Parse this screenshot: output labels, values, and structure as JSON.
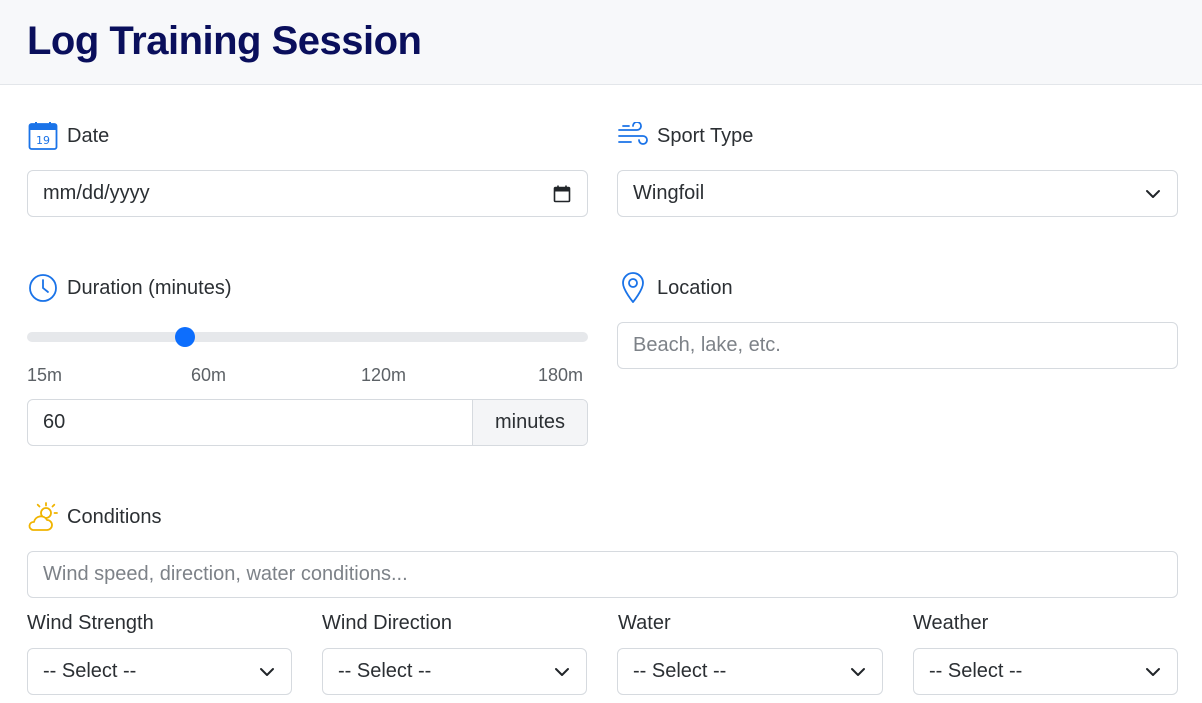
{
  "header": {
    "title": "Log Training Session"
  },
  "date": {
    "label": "Date",
    "placeholder": "mm/dd/yyyy",
    "icon": "calendar-icon",
    "icon_day": "19"
  },
  "sport": {
    "label": "Sport Type",
    "value": "Wingfoil",
    "icon": "wind-icon"
  },
  "duration": {
    "label": "Duration (minutes)",
    "icon": "clock-icon",
    "slider_value": 60,
    "slider_min": 15,
    "slider_max": 180,
    "ticks": [
      "15m",
      "60m",
      "120m",
      "180m"
    ],
    "value": "60",
    "unit": "minutes"
  },
  "location": {
    "label": "Location",
    "placeholder": "Beach, lake, etc.",
    "icon": "map-pin-icon"
  },
  "conditions": {
    "label": "Conditions",
    "placeholder": "Wind speed, direction, water conditions...",
    "icon": "sun-cloud-icon"
  },
  "selects": [
    {
      "label": "Wind Strength",
      "value": "-- Select --"
    },
    {
      "label": "Wind Direction",
      "value": "-- Select --"
    },
    {
      "label": "Water",
      "value": "-- Select --"
    },
    {
      "label": "Weather",
      "value": "-- Select --"
    }
  ],
  "colors": {
    "accent": "#0d6efd",
    "title": "#0a0f5c",
    "sun": "#f0b400"
  }
}
